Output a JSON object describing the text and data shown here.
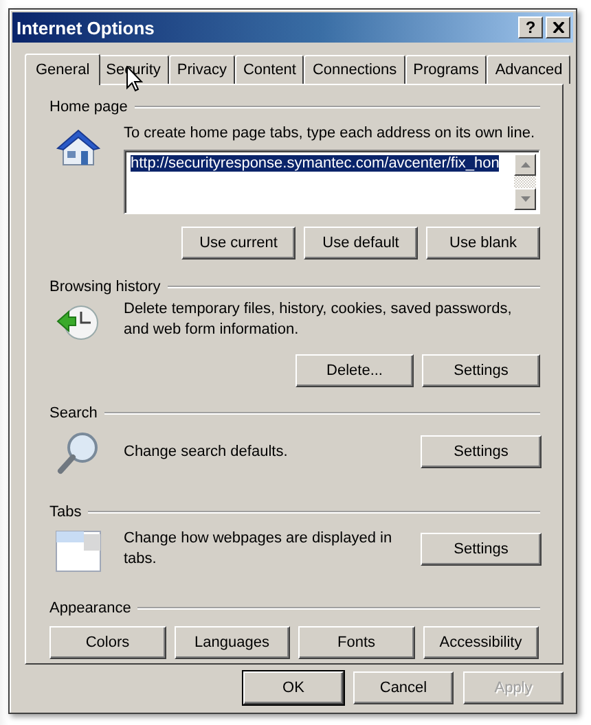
{
  "window": {
    "title": "Internet Options",
    "help_button": "?"
  },
  "tabs": [
    {
      "label": "General",
      "selected": true
    },
    {
      "label": "Security",
      "selected": false
    },
    {
      "label": "Privacy",
      "selected": false
    },
    {
      "label": "Content",
      "selected": false
    },
    {
      "label": "Connections",
      "selected": false
    },
    {
      "label": "Programs",
      "selected": false
    },
    {
      "label": "Advanced",
      "selected": false
    }
  ],
  "sections": [
    {
      "kind": "address",
      "title": "Home page",
      "description": "To create home page tabs, type each address on its own line.",
      "field": {
        "value": "http://securityresponse.symantec.com/avcenter/fix_hon",
        "text_selected": true
      },
      "buttons": [
        "Use current",
        "Use default",
        "Use blank"
      ]
    },
    {
      "kind": "info",
      "title": "Browsing history",
      "description": "Delete temporary files, history, cookies, saved passwords, and web form information.",
      "buttons": [
        "Delete...",
        "Settings"
      ]
    },
    {
      "kind": "inline",
      "title": "Search",
      "description": "Change search defaults.",
      "buttons": [
        "Settings"
      ]
    },
    {
      "kind": "inline",
      "title": "Tabs",
      "description": "Change how webpages are displayed in tabs.",
      "buttons": [
        "Settings"
      ]
    },
    {
      "kind": "buttons",
      "title": "Appearance",
      "buttons": [
        "Colors",
        "Languages",
        "Fonts",
        "Accessibility"
      ]
    }
  ],
  "footer_buttons": [
    {
      "label": "OK",
      "default": true,
      "disabled": false
    },
    {
      "label": "Cancel",
      "default": false,
      "disabled": false
    },
    {
      "label": "Apply",
      "default": false,
      "disabled": true
    }
  ]
}
